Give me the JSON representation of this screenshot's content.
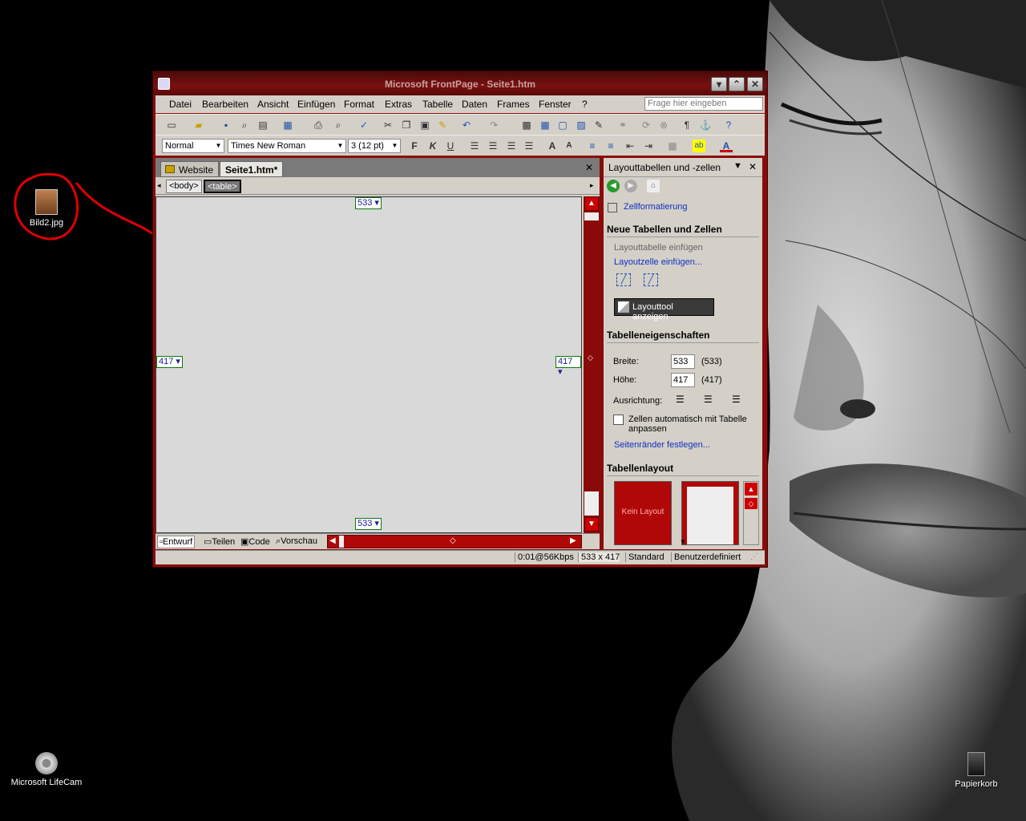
{
  "desktop": {
    "icons": [
      {
        "label": "Bild2.jpg"
      },
      {
        "label": "Microsoft LifeCam"
      },
      {
        "label": "Papierkorb"
      }
    ]
  },
  "window": {
    "title": "Microsoft FrontPage - Seite1.htm",
    "minimize_icon": "minimize-icon",
    "maximize_icon": "restore-icon",
    "close_icon": "close-icon"
  },
  "menu": {
    "items": [
      "Datei",
      "Bearbeiten",
      "Ansicht",
      "Einfügen",
      "Format",
      "Extras",
      "Tabelle",
      "Daten",
      "Frames",
      "Fenster",
      "?"
    ],
    "ask_placeholder": "Frage hier eingeben"
  },
  "format_toolbar": {
    "style": "Normal",
    "font": "Times New Roman",
    "size": "3 (12 pt)",
    "bold": "F",
    "italic": "K",
    "underline": "U"
  },
  "document": {
    "tabs": [
      "Website",
      "Seite1.htm*"
    ],
    "tags": [
      "<body>",
      "<table>"
    ],
    "width_label": "533",
    "height_label": "417",
    "view_tabs": [
      "Entwurf",
      "Teilen",
      "Code",
      "Vorschau"
    ]
  },
  "taskpane": {
    "title": "Layouttabellen und -zellen",
    "cell_format_link": "Zellformatierung",
    "section_new": "Neue Tabellen und Zellen",
    "insert_table": "Layouttabelle einfügen",
    "insert_cell": "Layoutzelle einfügen...",
    "layout_tool_button": "Layouttool anzeigen",
    "section_props": "Tabelleneigenschaften",
    "width_label": "Breite:",
    "width_value": "533",
    "width_paren": "(533)",
    "height_label": "Höhe:",
    "height_value": "417",
    "height_paren": "(417)",
    "align_label": "Ausrichtung:",
    "auto_fit_label": "Zellen automatisch mit Tabelle anpassen",
    "margins_link": "Seitenränder festlegen...",
    "section_layout": "Tabellenlayout",
    "no_layout": "Kein Layout"
  },
  "statusbar": {
    "speed": "0:01@56Kbps",
    "size": "533 x 417",
    "mode": "Standard",
    "custom": "Benutzerdefiniert"
  },
  "colors": {
    "window_frame": "#8b0a0a",
    "accent_red": "#cc0000",
    "annotation": "#e00000"
  }
}
